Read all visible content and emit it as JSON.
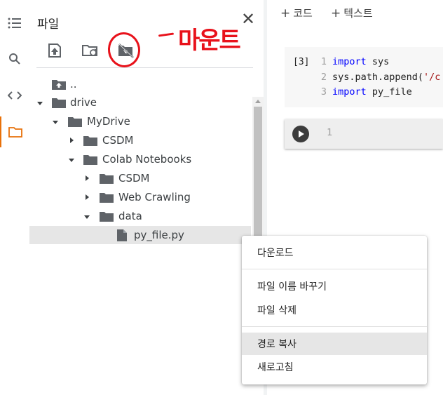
{
  "sidebar_rail": {
    "items": [
      {
        "icon": "menu-icon"
      },
      {
        "icon": "search-icon"
      },
      {
        "icon": "code-icon"
      },
      {
        "icon": "folder-icon"
      }
    ],
    "active_index": 3,
    "active_color": "#e8710a"
  },
  "files_panel": {
    "title": "파일",
    "close_label": "✕",
    "toolbar": [
      {
        "icon": "upload-icon"
      },
      {
        "icon": "refresh-folder-icon"
      },
      {
        "icon": "drive-mount-icon"
      }
    ],
    "tree": [
      {
        "label": "..",
        "type": "parent"
      },
      {
        "label": "drive",
        "type": "folder",
        "expanded": true
      },
      {
        "label": "MyDrive",
        "type": "folder",
        "expanded": true
      },
      {
        "label": "CSDM",
        "type": "folder",
        "expanded": false
      },
      {
        "label": "Colab Notebooks",
        "type": "folder",
        "expanded": true
      },
      {
        "label": "CSDM",
        "type": "folder",
        "expanded": false
      },
      {
        "label": "Web Crawling",
        "type": "folder",
        "expanded": false
      },
      {
        "label": "data",
        "type": "folder",
        "expanded": true
      },
      {
        "label": "py_file.py",
        "type": "file",
        "selected": true
      }
    ]
  },
  "annotation": {
    "text": "마운트",
    "color": "#e8121b"
  },
  "notebook": {
    "toolbar": [
      {
        "plus": "+",
        "label": "코드"
      },
      {
        "plus": "+",
        "label": "텍스트"
      }
    ],
    "cell1": {
      "exec_count": "[3]",
      "lines": [
        {
          "num": "1",
          "kw": "import",
          "rest": " sys"
        },
        {
          "num": "2",
          "text": "sys.path.append(",
          "str": "'/c"
        },
        {
          "num": "3",
          "kw": "import",
          "rest": " py_file"
        }
      ]
    },
    "cell2": {
      "line_num": "1"
    }
  },
  "context_menu": {
    "items": [
      {
        "label": "다운로드"
      },
      {
        "label": "파일 이름 바꾸기"
      },
      {
        "label": "파일 삭제"
      },
      {
        "label": "경로 복사",
        "hover": true
      },
      {
        "label": "새로고침"
      }
    ]
  }
}
